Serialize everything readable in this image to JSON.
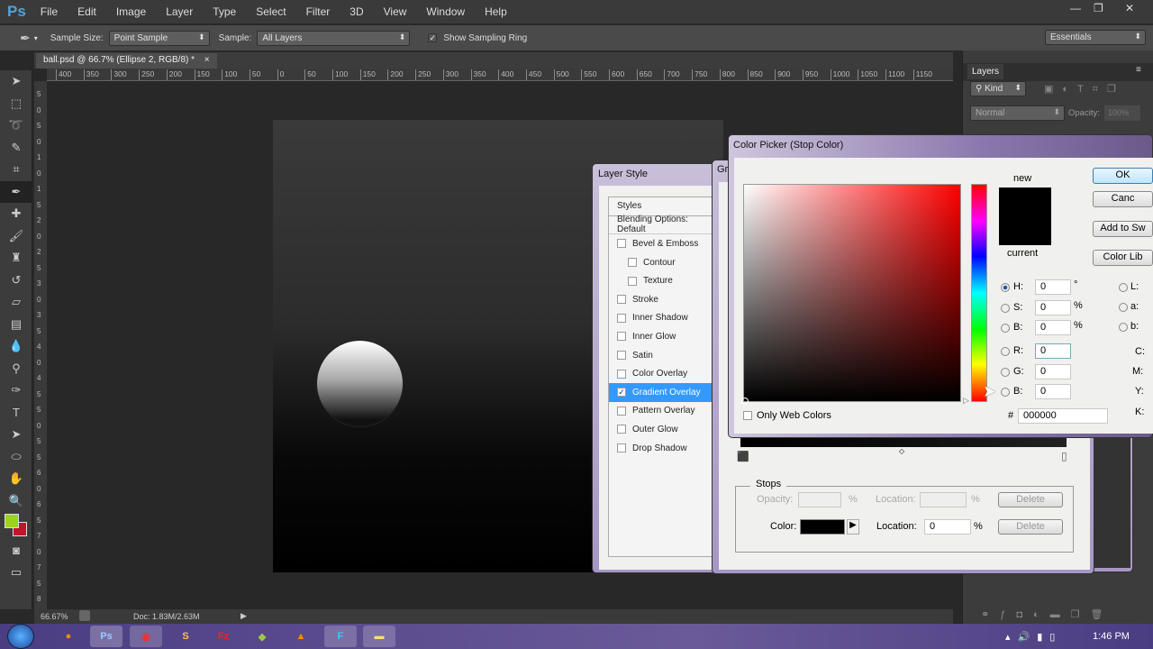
{
  "app": {
    "logo": "Ps",
    "menu": [
      "File",
      "Edit",
      "Image",
      "Layer",
      "Type",
      "Select",
      "Filter",
      "3D",
      "View",
      "Window",
      "Help"
    ],
    "window_controls": [
      "—",
      "❐",
      "✕"
    ]
  },
  "options": {
    "sample_size_label": "Sample Size:",
    "sample_size_value": "Point Sample",
    "sample_label": "Sample:",
    "sample_value": "All Layers",
    "show_ring_label": "Show Sampling Ring",
    "show_ring_checked": true,
    "workspace": "Essentials"
  },
  "document": {
    "tab_title": "ball.psd @ 66.7% (Ellipse 2, RGB/8) *",
    "close": "×",
    "ruler": [
      "400",
      "350",
      "300",
      "250",
      "200",
      "150",
      "100",
      "50",
      "0",
      "50",
      "100",
      "150",
      "200",
      "250",
      "300",
      "350",
      "400",
      "450",
      "500",
      "550",
      "600",
      "650",
      "700",
      "750",
      "800",
      "850",
      "900",
      "950",
      "1000",
      "1050",
      "1100",
      "1150"
    ],
    "vruler": [
      "5",
      "0",
      "5",
      "0",
      "1",
      "0",
      "1",
      "5",
      "2",
      "0",
      "2",
      "5",
      "3",
      "0",
      "3",
      "5",
      "4",
      "0",
      "4",
      "5",
      "5",
      "0",
      "5",
      "5",
      "6",
      "0",
      "6",
      "5",
      "7",
      "0",
      "7",
      "5",
      "8"
    ]
  },
  "status": {
    "zoom": "66.67%",
    "doc": "Doc: 1.83M/2.63M"
  },
  "layers_panel": {
    "title": "Layers",
    "filter": "Kind",
    "blend": "Normal",
    "opacity_label": "Opacity:",
    "opacity": "100%"
  },
  "colors": {
    "foreground": "#9bd41a",
    "background": "#c4142a",
    "accent": "#3399ff"
  },
  "layer_style": {
    "title": "Layer Style",
    "header": "Styles",
    "blending": "Blending Options: Default",
    "items": [
      {
        "label": "Bevel & Emboss",
        "checked": false
      },
      {
        "label": "Contour",
        "checked": false,
        "sub": true
      },
      {
        "label": "Texture",
        "checked": false,
        "sub": true
      },
      {
        "label": "Stroke",
        "checked": false
      },
      {
        "label": "Inner Shadow",
        "checked": false
      },
      {
        "label": "Inner Glow",
        "checked": false
      },
      {
        "label": "Satin",
        "checked": false
      },
      {
        "label": "Color Overlay",
        "checked": false
      },
      {
        "label": "Gradient Overlay",
        "checked": true,
        "selected": true
      },
      {
        "label": "Pattern Overlay",
        "checked": false
      },
      {
        "label": "Outer Glow",
        "checked": false
      },
      {
        "label": "Drop Shadow",
        "checked": false
      }
    ]
  },
  "gradient_editor": {
    "title_partial": "Gr",
    "stops_title": "Stops",
    "opacity_label": "Opacity:",
    "location_label": "Location:",
    "percent": "%",
    "delete": "Delete",
    "color_label": "Color:",
    "color_location": "0"
  },
  "color_picker": {
    "title": "Color Picker (Stop Color)",
    "new_label": "new",
    "current_label": "current",
    "ok": "OK",
    "cancel": "Canc",
    "add_swatches": "Add to Sw",
    "color_libraries": "Color Lib",
    "only_web": "Only Web Colors",
    "fields": [
      {
        "label": "H:",
        "value": "0",
        "unit": "°",
        "selected": true
      },
      {
        "label": "S:",
        "value": "0",
        "unit": "%"
      },
      {
        "label": "B:",
        "value": "0",
        "unit": "%"
      },
      {
        "label": "R:",
        "value": "0",
        "unit": ""
      },
      {
        "label": "G:",
        "value": "0",
        "unit": ""
      },
      {
        "label": "B:",
        "value": "0",
        "unit": ""
      }
    ],
    "lab": [
      "L:",
      "a:",
      "b:"
    ],
    "cmyk": [
      "C:",
      "M:",
      "Y:",
      "K:"
    ],
    "hash": "#",
    "hex": "000000"
  },
  "taskbar": {
    "time": "1:46 PM",
    "apps": [
      "Firefox",
      "Ps",
      "Chrome",
      "Sublime",
      "FileZilla",
      "Android",
      "VLC",
      "F",
      "Explorer"
    ]
  }
}
